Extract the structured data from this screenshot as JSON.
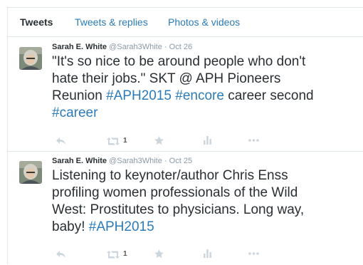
{
  "tabs": [
    {
      "label": "Tweets"
    },
    {
      "label": "Tweets & replies"
    },
    {
      "label": "Photos & videos"
    }
  ],
  "tweets": [
    {
      "fullname": "Sarah E. White",
      "screenname": "@Sarah3White",
      "dot": "·",
      "time": "Oct 26",
      "text": {
        "l1": "\"It's so nice to be around people who don't",
        "l2": "hate their jobs.\" SKT @ APH Pioneers",
        "l3_a": "Reunion ",
        "l3_h1": "#APH2015",
        "l3_sp": " ",
        "l3_h2": "#encore",
        "l3_b": " career second",
        "l4_h": "#career"
      },
      "retweet_count": "1"
    },
    {
      "fullname": "Sarah E. White",
      "screenname": "@Sarah3White",
      "dot": "·",
      "time": "Oct 25",
      "text": {
        "l1": "Listening to keynoter/author Chris Enss",
        "l2": "profiling women professionals of the Wild",
        "l3": "West: Prostitutes to physicians. Long way,",
        "l4_a": "baby! ",
        "l4_h": "#APH2015"
      },
      "retweet_count": "1"
    }
  ],
  "icons": {
    "reply": "reply-icon",
    "retweet": "retweet-icon",
    "favorite": "star-icon",
    "stats": "stats-icon",
    "more": "more-icon"
  },
  "colors": {
    "link": "#2b7bb9",
    "text": "#292f33",
    "muted": "#8899a6",
    "icon": "#ccd6dd",
    "border": "#e1e8ed"
  }
}
